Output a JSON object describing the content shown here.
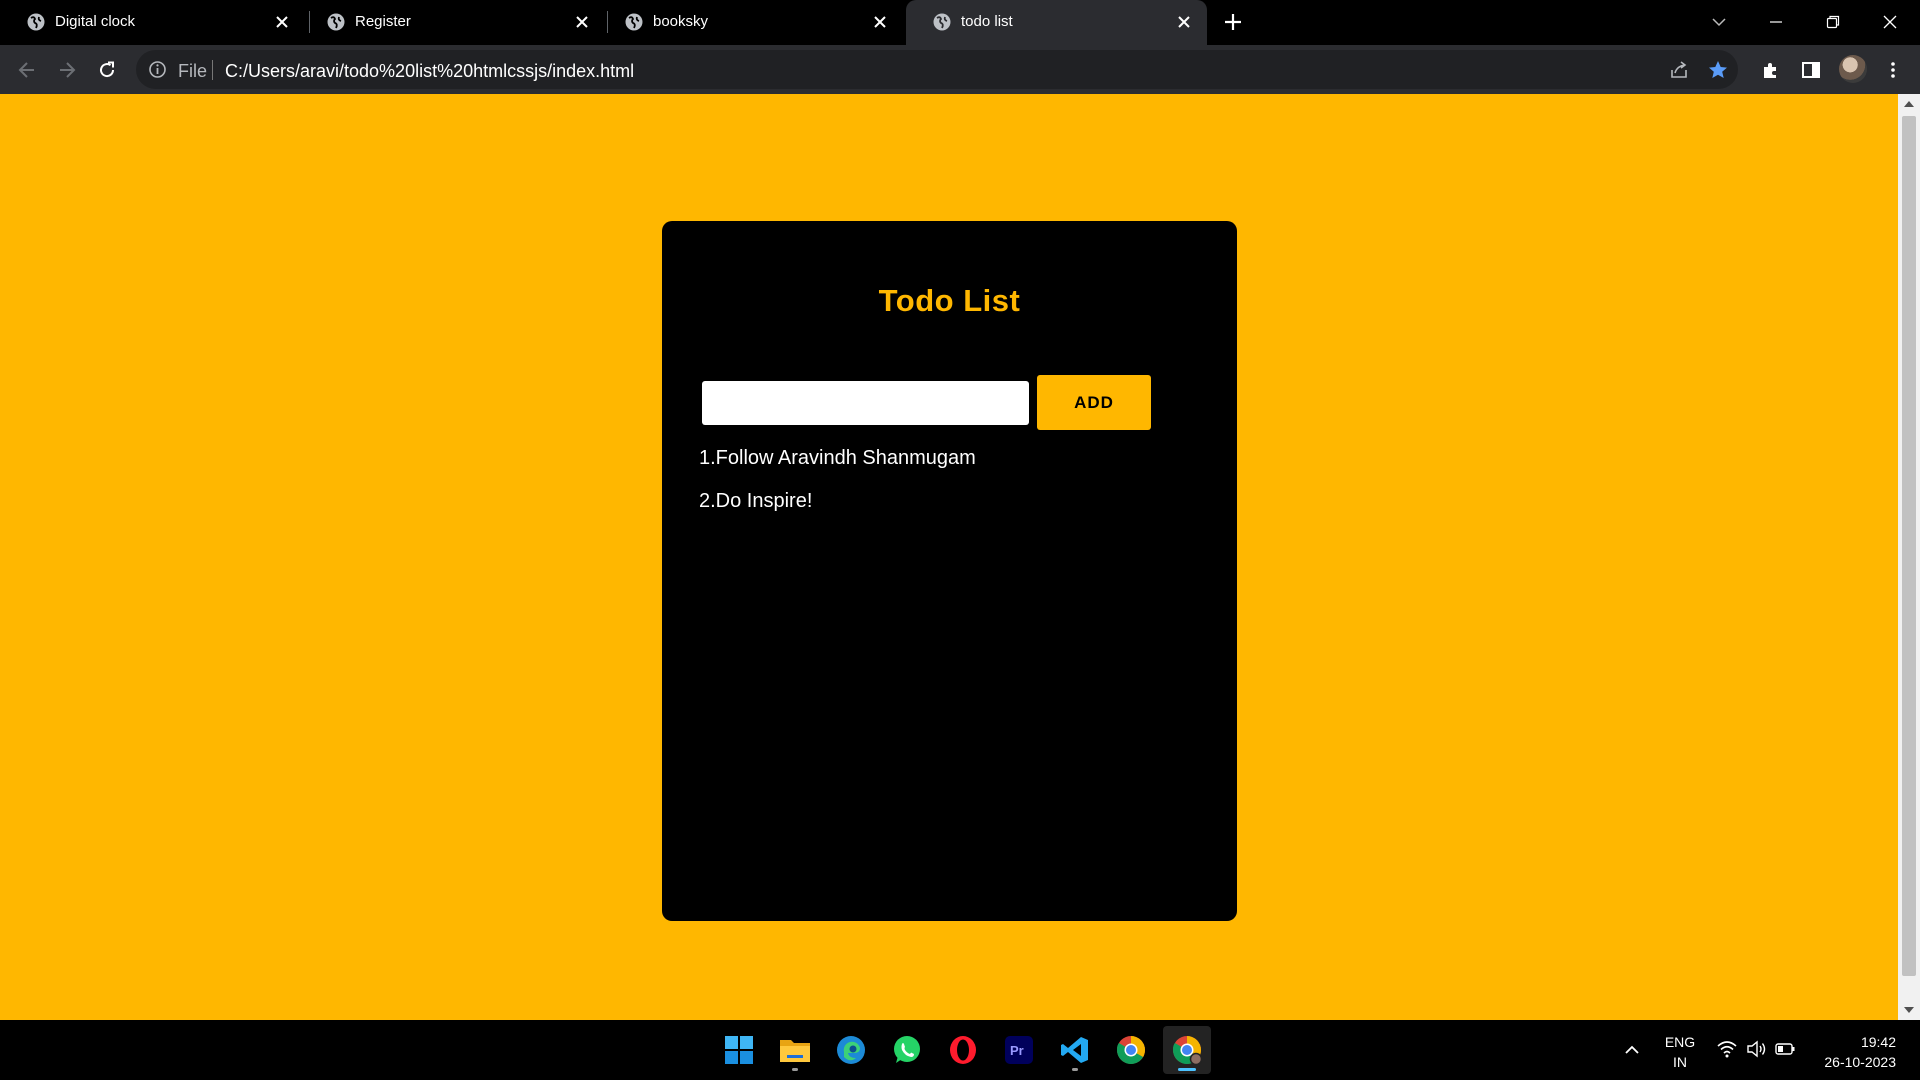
{
  "browser": {
    "tabs": [
      {
        "title": "Digital clock",
        "active": false
      },
      {
        "title": "Register",
        "active": false
      },
      {
        "title": "booksky",
        "active": false
      },
      {
        "title": "todo list",
        "active": true
      }
    ],
    "address": {
      "scheme_label": "File",
      "url": "C:/Users/aravi/todo%20list%20htmlcssjs/index.html"
    }
  },
  "page": {
    "title": "Todo List",
    "input": {
      "value": "",
      "placeholder": ""
    },
    "add_label": "ADD",
    "items": [
      "1.Follow Aravindh Shanmugam",
      "2.Do Inspire!"
    ]
  },
  "taskbar": {
    "language_line1": "ENG",
    "language_line2": "IN",
    "time": "19:42",
    "date": "26-10-2023",
    "apps": [
      "start-icon",
      "file-explorer-icon",
      "edge-icon",
      "whatsapp-icon",
      "opera-icon",
      "premiere-pro-icon",
      "vscode-icon",
      "chrome-icon",
      "chrome-profile-icon"
    ]
  },
  "colors": {
    "accent": "#ffb700",
    "card": "#000000",
    "item_text": "#ffffff",
    "tab_active": "#2b2c30"
  }
}
